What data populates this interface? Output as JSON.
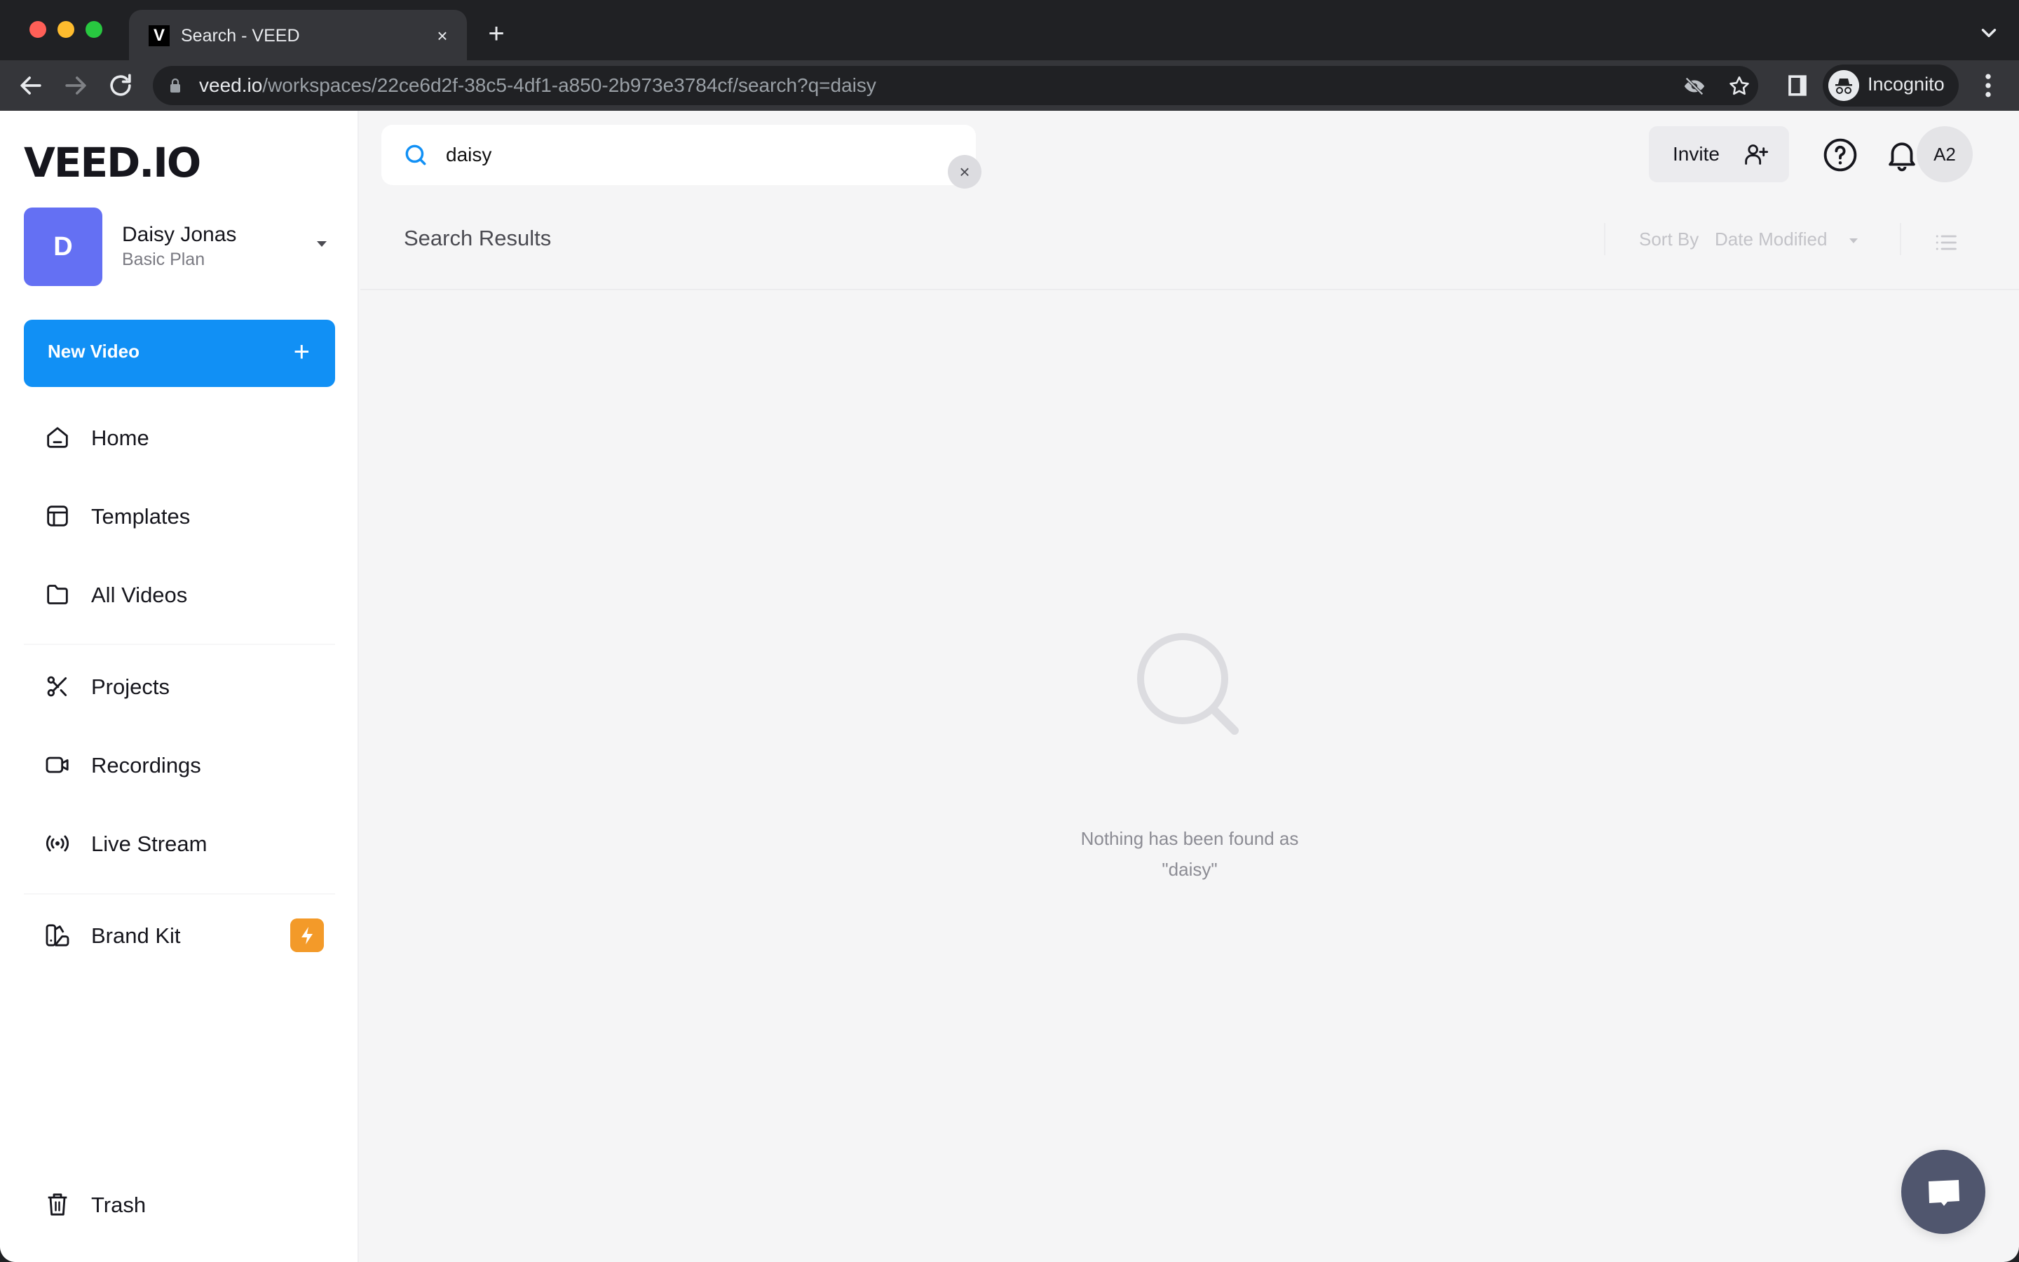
{
  "browser": {
    "tab_title": "Search - VEED",
    "tab_favicon": "V",
    "url_host": "veed.io",
    "url_path": "/workspaces/22ce6d2f-38c5-4df1-a850-2b973e3784cf/search?q=daisy",
    "profile_label": "Incognito",
    "new_tab_symbol": "+",
    "close_symbol": "×"
  },
  "sidebar": {
    "logo": "VEED.IO",
    "workspace": {
      "initial": "D",
      "name": "Daisy Jonas",
      "plan": "Basic Plan",
      "avatar_color": "#6470f3"
    },
    "new_video_label": "New Video",
    "new_video_symbol": "+",
    "nav_items": [
      {
        "label": "Home",
        "icon": "home-icon"
      },
      {
        "label": "Templates",
        "icon": "templates-icon"
      },
      {
        "label": "All Videos",
        "icon": "folder-icon"
      },
      {
        "label": "Projects",
        "icon": "scissors-icon"
      },
      {
        "label": "Recordings",
        "icon": "video-camera-icon"
      },
      {
        "label": "Live Stream",
        "icon": "broadcast-icon"
      },
      {
        "label": "Brand Kit",
        "icon": "brand-kit-icon",
        "badge": "lightning-icon"
      },
      {
        "label": "Trash",
        "icon": "trash-icon"
      }
    ]
  },
  "header": {
    "search": {
      "value": "daisy",
      "placeholder": "",
      "clear_symbol": "×"
    },
    "invite_label": "Invite",
    "user_initials": "A2"
  },
  "results": {
    "title": "Search Results",
    "sort_by_label": "Sort By",
    "sort_value": "Date Modified",
    "empty_message_line1": "Nothing has been found as",
    "empty_message_line2": "\"daisy\""
  },
  "colors": {
    "accent": "#1190f5",
    "badge": "#f39a29",
    "chat_fab": "#50566e"
  }
}
